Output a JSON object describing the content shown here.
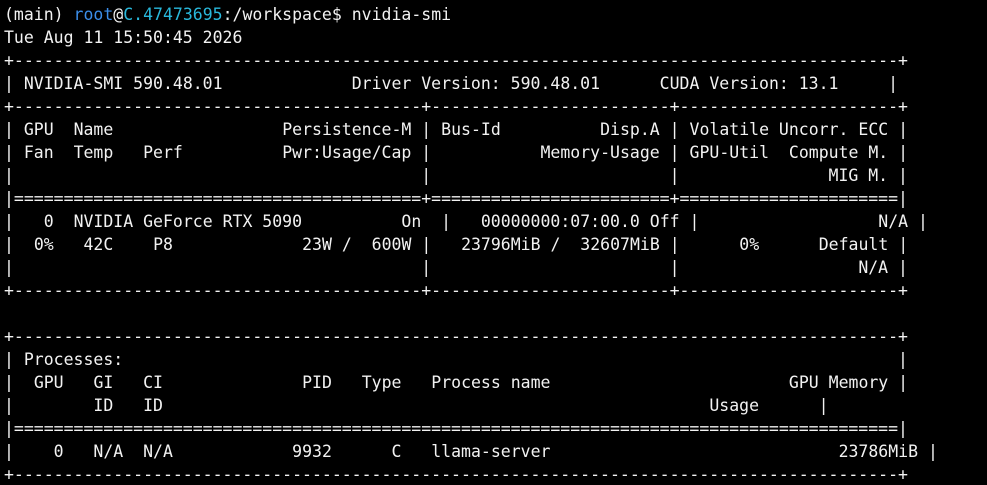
{
  "prompt": {
    "env": "(main)",
    "user": "root",
    "at": "@",
    "host": "C.47473695",
    "path": ":/workspace$",
    "command": "nvidia-smi"
  },
  "timestamp": "Tue Aug 11 15:50:45 2026",
  "smi": {
    "header": {
      "version": "NVIDIA-SMI 590.48.01",
      "driver": "Driver Version: 590.48.01",
      "cuda": "CUDA Version: 13.1"
    },
    "gpu_columns": {
      "row1": [
        "GPU",
        "Name",
        "Persistence-M",
        "Bus-Id",
        "Disp.A",
        "Volatile Uncorr. ECC"
      ],
      "row2": [
        "Fan",
        "Temp",
        "Perf",
        "Pwr:Usage/Cap",
        "Memory-Usage",
        "GPU-Util",
        "Compute M."
      ],
      "row3": [
        "MIG M."
      ]
    },
    "gpus": [
      {
        "index": "0",
        "name": "NVIDIA GeForce RTX 5090",
        "persistence": "On",
        "bus_id": "00000000:07:00.0",
        "disp_a": "Off",
        "ecc": "N/A",
        "fan": "0%",
        "temp": "42C",
        "perf": "P8",
        "power_usage": "23W",
        "power_cap": "600W",
        "memory_used": "23796MiB",
        "memory_total": "32607MiB",
        "gpu_util": "0%",
        "compute_mode": "Default",
        "mig_mode": "N/A"
      }
    ],
    "processes_title": "Processes:",
    "process_columns": {
      "row1": [
        "GPU",
        "GI",
        "CI",
        "PID",
        "Type",
        "Process name",
        "GPU Memory"
      ],
      "row2": [
        "ID",
        "ID",
        "Usage"
      ]
    },
    "processes": [
      {
        "gpu": "0",
        "gi_id": "N/A",
        "ci_id": "N/A",
        "pid": "9932",
        "type": "C",
        "name": "llama-server",
        "memory": "23786MiB"
      }
    ]
  }
}
